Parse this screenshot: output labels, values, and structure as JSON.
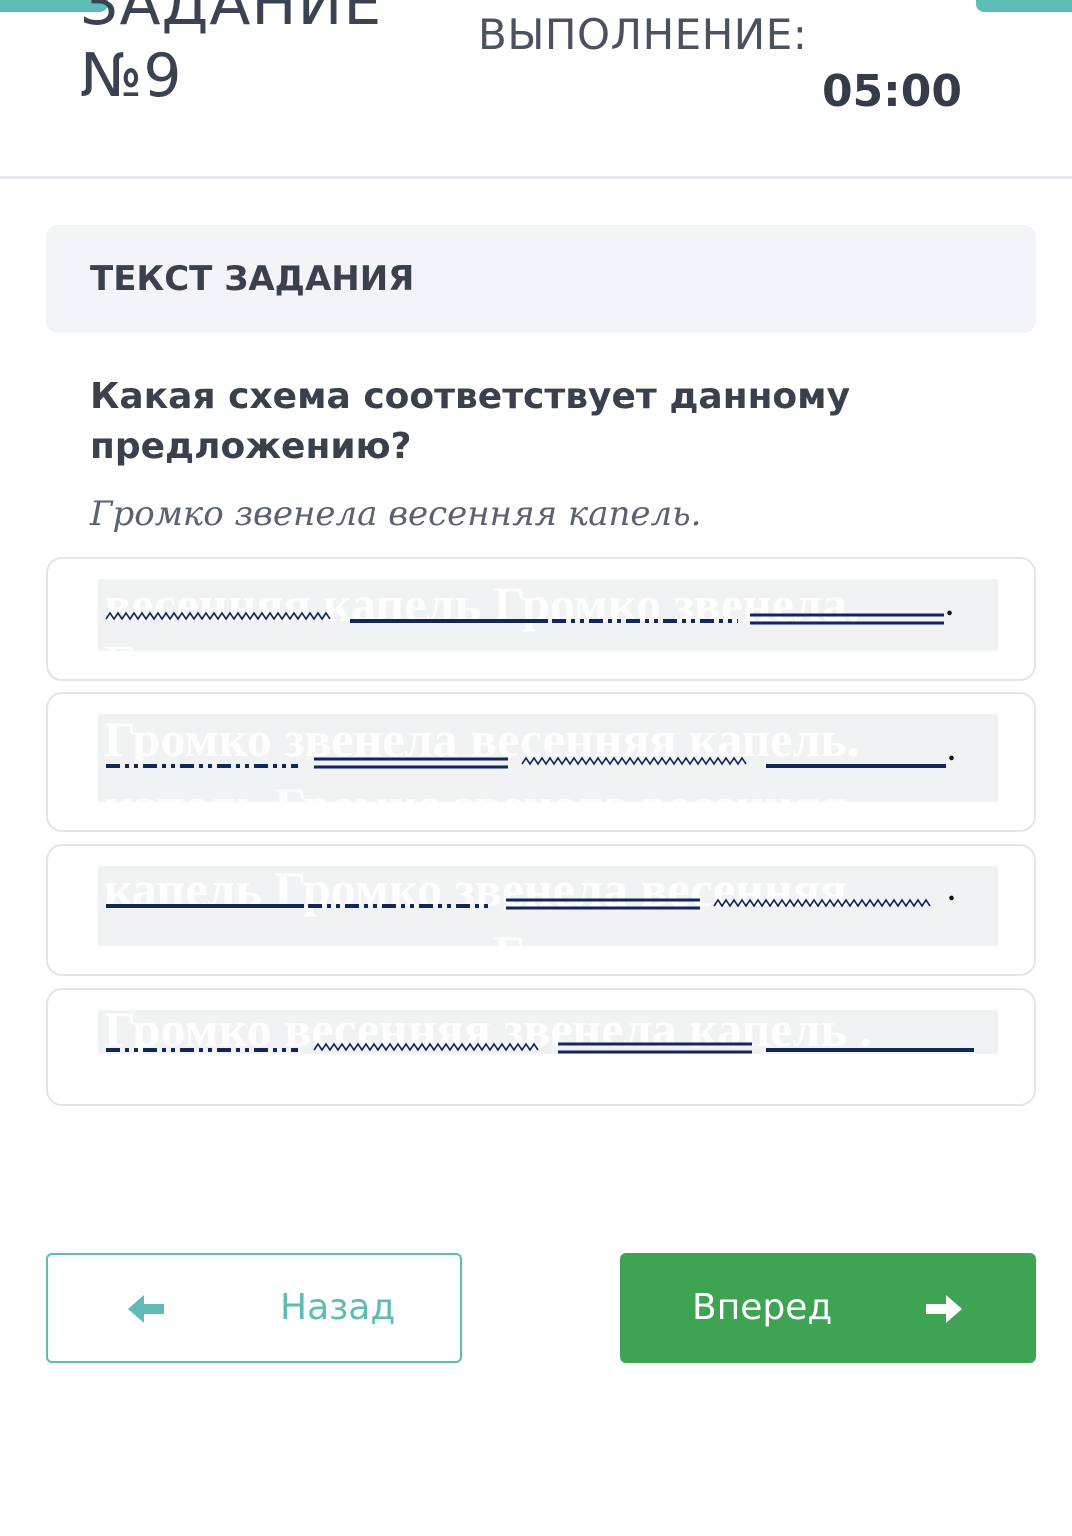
{
  "header": {
    "task_title_line1": "ЗАДАНИЕ",
    "task_title_line2": "№9",
    "exec_label": "ВЫПОЛНЕНИЕ:",
    "timer": "05:00"
  },
  "section": {
    "title": "ТЕКСТ ЗАДАНИЯ"
  },
  "question": {
    "text": "Какая схема соответствует данному предложению?",
    "sentence": "Громко звенела весенняя капель."
  },
  "options": [
    {
      "ghost_top": "весенняя капель Громко звенела.",
      "ghost_bottom": "Громко звенела весенняя капель",
      "end_mark": "."
    },
    {
      "ghost_top": "Громко звенела весенняя капель.",
      "ghost_bottom": "капель Громко звенела весенняя",
      "end_mark": "."
    },
    {
      "ghost_top": "капель Громко звенела весенняя.",
      "ghost_bottom": "весенняя капель Громко звенела",
      "end_mark": "."
    },
    {
      "ghost_top": "Громко весенняя звенела капель .",
      "ghost_bottom": "",
      "end_mark": ""
    }
  ],
  "nav": {
    "back_label": "Назад",
    "next_label": "Вперед",
    "back_icon": "arrow-left-icon",
    "next_icon": "arrow-right-icon"
  },
  "colors": {
    "accent_teal": "#5fbcb4",
    "next_green": "#3ea454",
    "underline_navy": "#14275a"
  }
}
